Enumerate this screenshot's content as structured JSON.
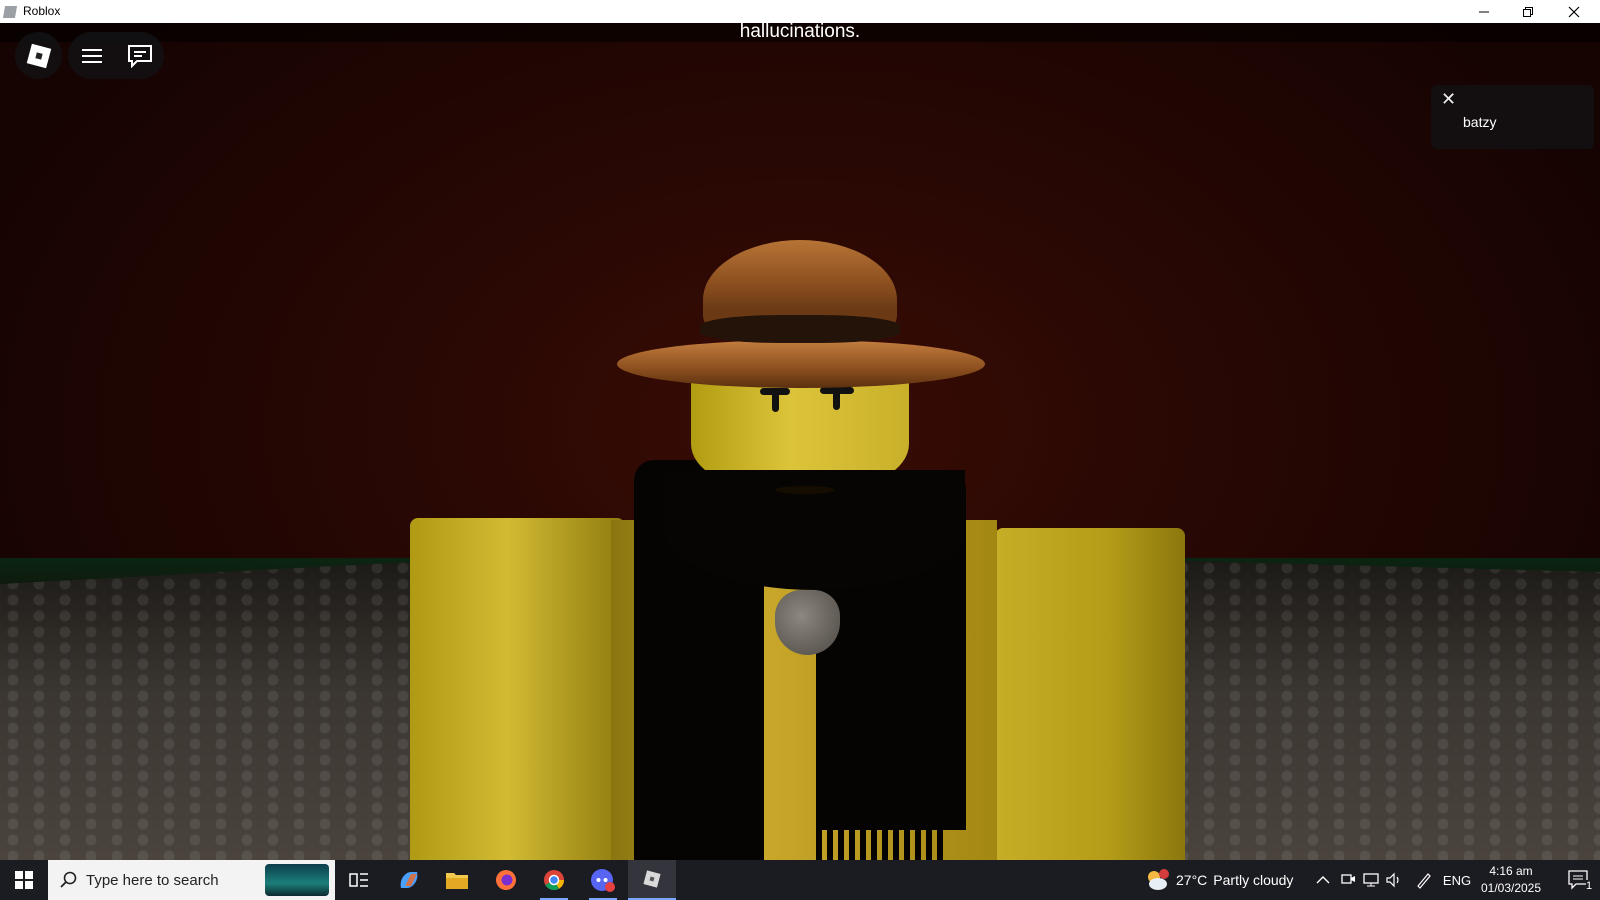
{
  "window": {
    "title": "Roblox",
    "controls": [
      "minimize-icon",
      "restore-icon",
      "close-icon"
    ]
  },
  "game": {
    "caption": "hallucinations.",
    "player_list": {
      "players": [
        "batzy"
      ]
    }
  },
  "taskbar": {
    "search_placeholder": "Type here to search",
    "pinned_apps": [
      "task-view-icon",
      "copilot-icon",
      "file-explorer-icon",
      "firefox-icon",
      "chrome-icon",
      "discord-icon",
      "roblox-icon"
    ],
    "weather": {
      "temperature": "27°C",
      "condition": "Partly cloudy",
      "alert_count": "1"
    },
    "language": "ENG",
    "time": "4:16 am",
    "date": "01/03/2025",
    "notification_count": "1"
  },
  "colors": {
    "taskbar_bg": "#1b1b22",
    "scene_bg": "#2a0804",
    "accent": "#7aa7ff"
  }
}
